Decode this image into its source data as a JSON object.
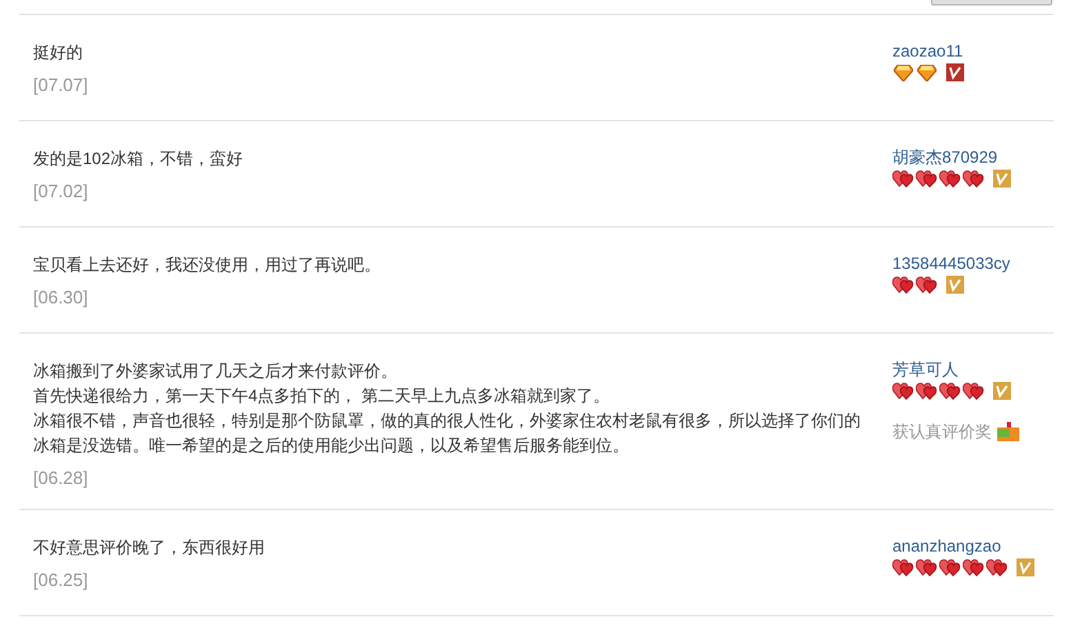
{
  "reviews": [
    {
      "lines": [
        "挺好的"
      ],
      "date": "[07.07]",
      "user": "zaozao11",
      "rank_icons": [
        {
          "kind": "diamond"
        },
        {
          "kind": "diamond"
        }
      ],
      "color": "#b8312a"
    },
    {
      "lines": [
        "发的是102冰箱，不错，蛮好"
      ],
      "date": "[07.02]",
      "user": "胡豪杰870929",
      "rank_icons": [
        {
          "kind": "heart"
        },
        {
          "kind": "heart"
        },
        {
          "kind": "heart"
        },
        {
          "kind": "heart"
        }
      ],
      "color": "#d9a441"
    },
    {
      "lines": [
        "宝贝看上去还好，我还没使用，用过了再说吧。"
      ],
      "date": "[06.30]",
      "user": "13584445033cy",
      "rank_icons": [
        {
          "kind": "heart"
        },
        {
          "kind": "heart"
        }
      ],
      "color": "#d9a441"
    },
    {
      "lines": [
        "冰箱搬到了外婆家试用了几天之后才来付款评价。",
        "首先快递很给力，第一天下午4点多拍下的， 第二天早上九点多冰箱就到家了。",
        "冰箱很不错，声音也很轻，特别是那个防鼠罩，做的真的很人性化，外婆家住农村老鼠有很多，所以选择了你们的",
        "冰箱是没选错。唯一希望的是之后的使用能少出问题，以及希望售后服务能到位。"
      ],
      "date": "[06.28]",
      "user": "芳草可人",
      "rank_icons": [
        {
          "kind": "heart"
        },
        {
          "kind": "heart"
        },
        {
          "kind": "heart"
        },
        {
          "kind": "heart"
        }
      ],
      "color": "#d9a441",
      "award": "获认真评价奖"
    },
    {
      "lines": [
        "不好意思评价晚了，东西很好用"
      ],
      "date": "[06.25]",
      "user": "ananzhangzao",
      "rank_icons": [
        {
          "kind": "heart"
        },
        {
          "kind": "heart"
        },
        {
          "kind": "heart"
        },
        {
          "kind": "heart"
        },
        {
          "kind": "heart"
        }
      ],
      "color": "#d9a441"
    }
  ]
}
